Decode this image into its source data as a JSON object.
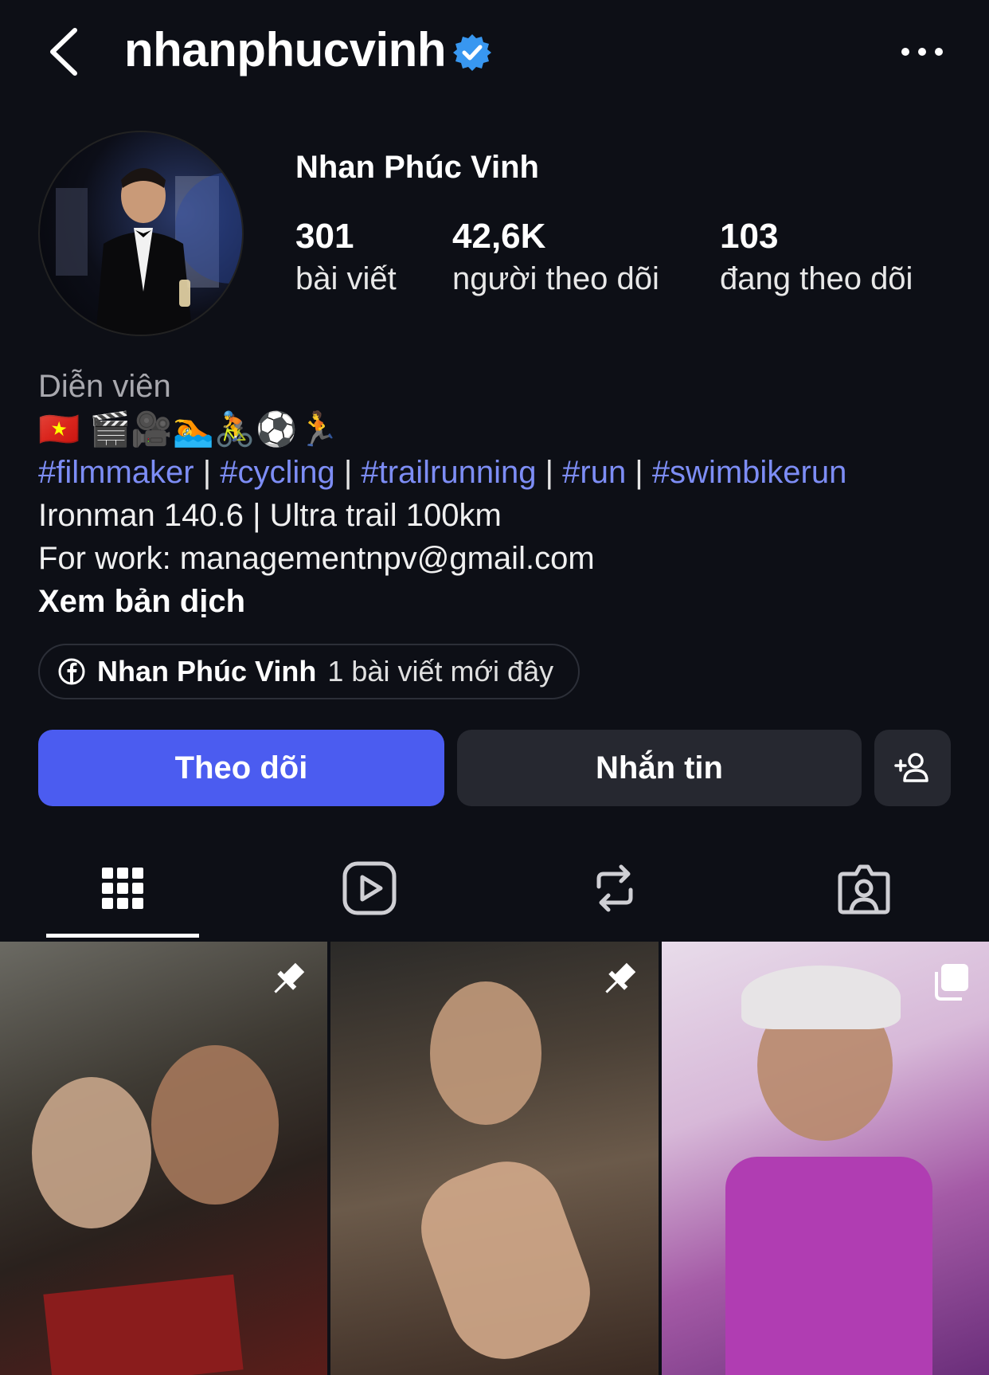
{
  "header": {
    "username": "nhanphucvinh",
    "verified": true,
    "icons": {
      "back": "chevron-left-icon",
      "verified": "verified-badge-icon",
      "more": "more-horizontal-icon"
    }
  },
  "profile": {
    "display_name": "Nhan Phúc Vinh",
    "stats": [
      {
        "value": "301",
        "label": "bài viết"
      },
      {
        "value": "42,6K",
        "label": "người theo dõi"
      },
      {
        "value": "103",
        "label": "đang theo dõi"
      }
    ]
  },
  "bio": {
    "category": "Diễn viên",
    "emojis": "🇻🇳 🎬🎥🏊🚴⚽🏃",
    "hashtags": [
      "#filmmaker",
      "#cycling",
      "#trailrunning",
      "#run",
      "#swimbikerun"
    ],
    "separators": [
      " | ",
      " | ",
      " | ",
      " | "
    ],
    "line1": "Ironman 140.6 | Ultra trail 100km",
    "line2": "For work: managementnpv@gmail.com",
    "translate": "Xem bản dịch"
  },
  "facebook_pill": {
    "name": "Nhan Phúc Vinh",
    "meta": "1 bài viết mới đây",
    "icon": "facebook-icon"
  },
  "actions": {
    "follow": "Theo dõi",
    "message": "Nhắn tin",
    "add_icon": "add-person-icon"
  },
  "tabs": [
    {
      "name": "grid",
      "icon": "grid-icon",
      "active": true
    },
    {
      "name": "reels",
      "icon": "reels-icon",
      "active": false
    },
    {
      "name": "reposts",
      "icon": "repost-icon",
      "active": false
    },
    {
      "name": "tagged",
      "icon": "tagged-person-icon",
      "active": false
    }
  ],
  "grid": [
    {
      "pinned": true,
      "icon": "pin-icon"
    },
    {
      "pinned": true,
      "icon": "pin-icon"
    },
    {
      "pinned": false,
      "multi": true,
      "icon": "multiple-posts-icon"
    }
  ],
  "colors": {
    "background": "#0d0f16",
    "accent": "#4b5cf0",
    "hashtag": "#7d8df5",
    "verified": "#3897f0"
  }
}
